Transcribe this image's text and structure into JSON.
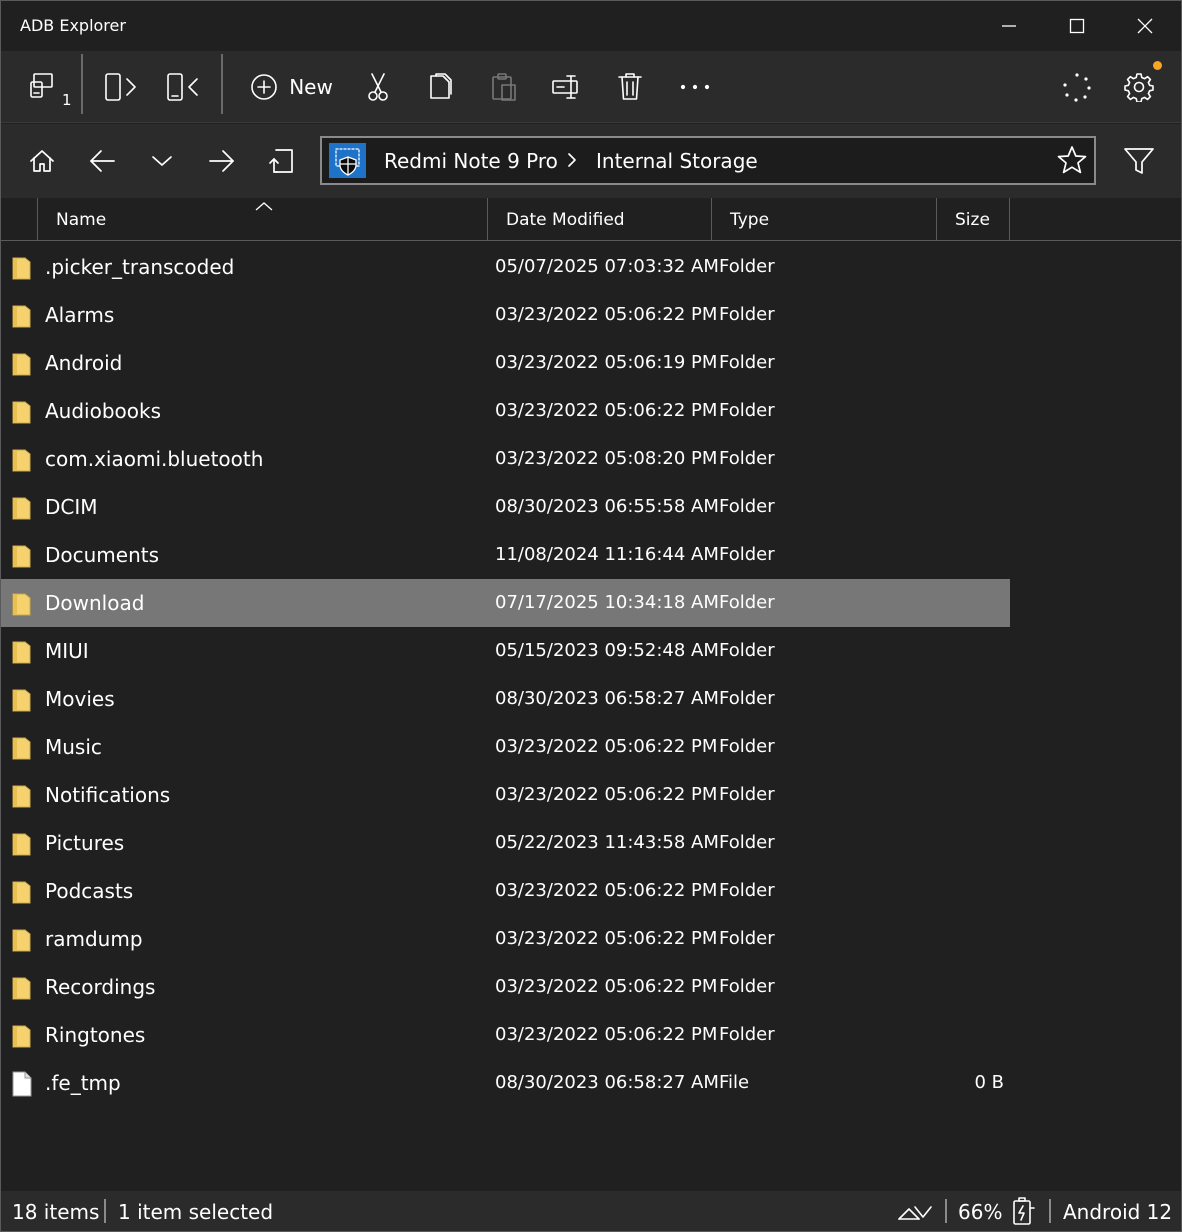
{
  "window": {
    "title": "ADB Explorer"
  },
  "toolbar": {
    "device_count": "1",
    "new_label": "New",
    "icons": [
      "devices-icon",
      "push-icon",
      "pull-icon",
      "new-icon",
      "cut-icon",
      "copy-icon",
      "paste-icon",
      "rename-icon",
      "delete-icon",
      "more-icon",
      "sync-icon",
      "settings-icon"
    ]
  },
  "address": {
    "device": "Redmi Note 9 Pro",
    "location": "Internal Storage"
  },
  "columns": {
    "name": "Name",
    "date": "Date Modified",
    "type": "Type",
    "size": "Size"
  },
  "files": [
    {
      "name": ".picker_transcoded",
      "date": "05/07/2025 07:03:32 AM",
      "type": "Folder",
      "size": "",
      "kind": "folder"
    },
    {
      "name": "Alarms",
      "date": "03/23/2022 05:06:22 PM",
      "type": "Folder",
      "size": "",
      "kind": "folder"
    },
    {
      "name": "Android",
      "date": "03/23/2022 05:06:19 PM",
      "type": "Folder",
      "size": "",
      "kind": "folder"
    },
    {
      "name": "Audiobooks",
      "date": "03/23/2022 05:06:22 PM",
      "type": "Folder",
      "size": "",
      "kind": "folder"
    },
    {
      "name": "com.xiaomi.bluetooth",
      "date": "03/23/2022 05:08:20 PM",
      "type": "Folder",
      "size": "",
      "kind": "folder"
    },
    {
      "name": "DCIM",
      "date": "08/30/2023 06:55:58 AM",
      "type": "Folder",
      "size": "",
      "kind": "folder"
    },
    {
      "name": "Documents",
      "date": "11/08/2024 11:16:44 AM",
      "type": "Folder",
      "size": "",
      "kind": "folder"
    },
    {
      "name": "Download",
      "date": "07/17/2025 10:34:18 AM",
      "type": "Folder",
      "size": "",
      "kind": "folder",
      "selected": true
    },
    {
      "name": "MIUI",
      "date": "05/15/2023 09:52:48 AM",
      "type": "Folder",
      "size": "",
      "kind": "folder"
    },
    {
      "name": "Movies",
      "date": "08/30/2023 06:58:27 AM",
      "type": "Folder",
      "size": "",
      "kind": "folder"
    },
    {
      "name": "Music",
      "date": "03/23/2022 05:06:22 PM",
      "type": "Folder",
      "size": "",
      "kind": "folder"
    },
    {
      "name": "Notifications",
      "date": "03/23/2022 05:06:22 PM",
      "type": "Folder",
      "size": "",
      "kind": "folder"
    },
    {
      "name": "Pictures",
      "date": "05/22/2023 11:43:58 AM",
      "type": "Folder",
      "size": "",
      "kind": "folder"
    },
    {
      "name": "Podcasts",
      "date": "03/23/2022 05:06:22 PM",
      "type": "Folder",
      "size": "",
      "kind": "folder"
    },
    {
      "name": "ramdump",
      "date": "03/23/2022 05:06:22 PM",
      "type": "Folder",
      "size": "",
      "kind": "folder"
    },
    {
      "name": "Recordings",
      "date": "03/23/2022 05:06:22 PM",
      "type": "Folder",
      "size": "",
      "kind": "folder"
    },
    {
      "name": "Ringtones",
      "date": "03/23/2022 05:06:22 PM",
      "type": "Folder",
      "size": "",
      "kind": "folder"
    },
    {
      "name": ".fe_tmp",
      "date": "08/30/2023 06:58:27 AM",
      "type": "File",
      "size": "0 B",
      "kind": "file"
    }
  ],
  "status": {
    "items": "18 items",
    "selected": "1 item selected",
    "battery": "66%",
    "android": "Android 12"
  },
  "colors": {
    "background": "#202020",
    "bars": "#2b2b2b",
    "selected_row": "#777777",
    "folder": "#f5d26e",
    "accent": "#1e73c9",
    "notify": "#f5a623"
  }
}
